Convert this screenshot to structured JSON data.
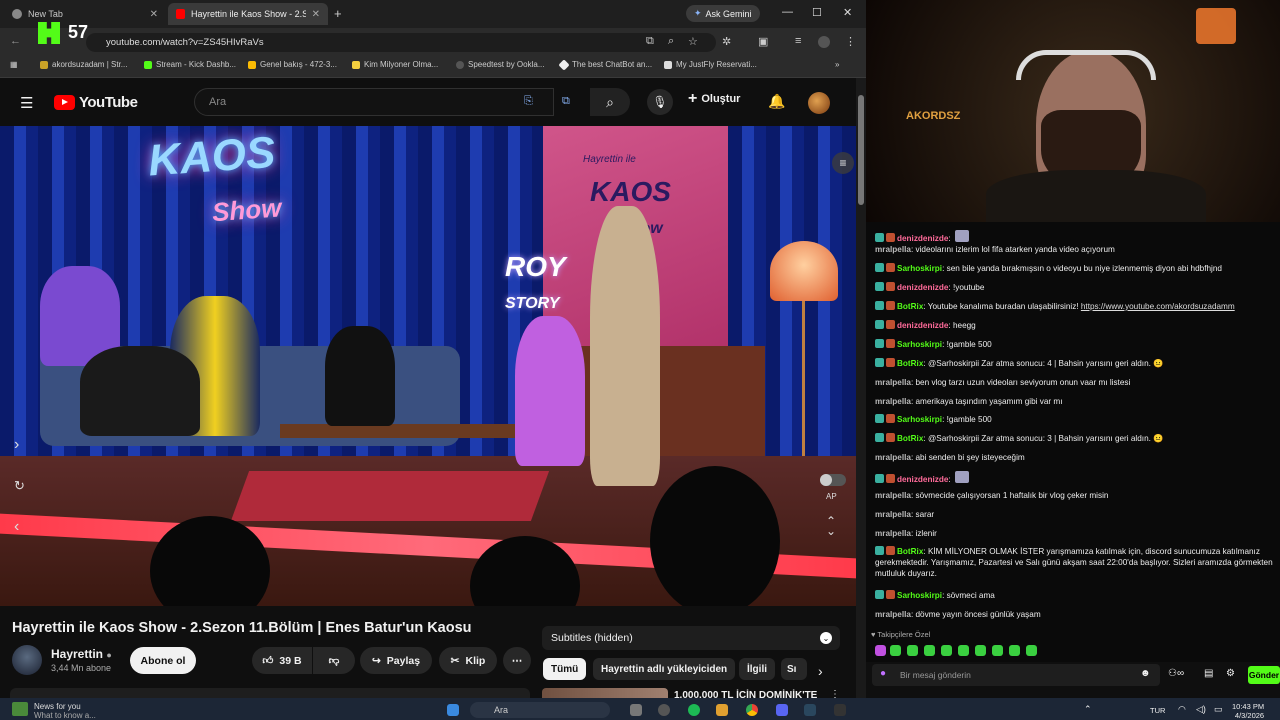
{
  "browser": {
    "tabs": [
      {
        "label": "New Tab",
        "active": false
      },
      {
        "label": "Hayrettin ile Kaos Show - 2.Sez",
        "active": true
      }
    ],
    "ask_gemini": "Ask Gemini",
    "url": "youtube.com/watch?v=ZS45HIvRaVs",
    "bookmarks": [
      "akordsuzadam | Str...",
      "Stream - Kick Dashb...",
      "Genel bakış - 472-3...",
      "Kim Milyoner Olma...",
      "Speedtest by Ookla...",
      "The best ChatBot an...",
      "My JustFly Reservati..."
    ]
  },
  "kick_overlay": {
    "logo": "K",
    "count": "57"
  },
  "youtube": {
    "logo": "YouTube",
    "search_placeholder": "Ara",
    "create_label": "Oluştur",
    "video_title": "Hayrettin ile Kaos Show - 2.Sezon 11.Bölüm | Enes Batur'un Kaosu",
    "channel": {
      "name": "Hayrettin",
      "subscribers": "3,44 Mn abone",
      "subscribe_label": "Abone ol"
    },
    "actions": {
      "likes": "39 B",
      "share": "Paylaş",
      "clip": "Klip"
    },
    "ap_label": "AP",
    "subtitles_label": "Subtitles (hidden)",
    "chips": [
      "Tümü",
      "Hayrettin adlı yükleyiciden",
      "İlgili",
      "Sı"
    ],
    "next_video_title": "1.000.000 TL İÇİN DOMİNİK'TE",
    "video_signs": {
      "kaos": "KAOS",
      "show": "Show",
      "roy": "ROY",
      "story": "STORY",
      "small": "Hayrettin ile",
      "panel_kaos": "KAOS",
      "panel_show": "Show"
    },
    "stream_overlay_label": "AKORDSZ"
  },
  "chat": {
    "messages": [
      {
        "user": "denizdenizde",
        "text": ":",
        "color": "#ff6b9a",
        "emote": true
      },
      {
        "user": "mralpella",
        "text": ": videolarını izlerim lol fifa atarken yanda video açıyorum",
        "color": "#bbbbbb"
      },
      {
        "user": "Sarhoskirpi",
        "text": ": sen bile yanda bırakmışsın o videoyu bu niye izlenmemiş diyon abi hdbfhjnd",
        "color": "#53fc18"
      },
      {
        "user": "denizdenizde",
        "text": ": !youtube",
        "color": "#ff6b9a"
      },
      {
        "user": "BotRix",
        "text": ": Youtube kanalıma buradan ulaşabilirsiniz! ",
        "link": "https://www.youtube.com/akordsuzadamm",
        "color": "#53fc18"
      },
      {
        "user": "denizdenizde",
        "text": ": heegg",
        "color": "#ff6b9a"
      },
      {
        "user": "Sarhoskirpi",
        "text": ": !gamble 500",
        "color": "#53fc18"
      },
      {
        "user": "BotRix",
        "text": ": @Sarhoskirpii Zar atma sonucu: 4 | Bahsin yarısını geri aldın. 😐",
        "color": "#53fc18"
      },
      {
        "user": "mralpella",
        "text": ": ben vlog tarzı uzun videoları seviyorum onun vaar mı listesi",
        "color": "#bbbbbb"
      },
      {
        "user": "mralpella",
        "text": ": amerikaya taşındım yaşamım gibi var mı",
        "color": "#bbbbbb"
      },
      {
        "user": "Sarhoskirpi",
        "text": ": !gamble 500",
        "color": "#53fc18"
      },
      {
        "user": "BotRix",
        "text": ": @Sarhoskirpii Zar atma sonucu: 3 | Bahsin yarısını geri aldın. 😐",
        "color": "#53fc18"
      },
      {
        "user": "mralpella",
        "text": ": abi senden bi şey isteyeceğim",
        "color": "#bbbbbb"
      },
      {
        "user": "denizdenizde",
        "text": ":",
        "color": "#ff6b9a",
        "emote": true
      },
      {
        "user": "mralpella",
        "text": ": sövmecide çalışıyorsan 1 haftalık bir vlog çeker misin",
        "color": "#bbbbbb"
      },
      {
        "user": "mralpella",
        "text": ": sarar",
        "color": "#bbbbbb"
      },
      {
        "user": "mralpella",
        "text": ": izlenir",
        "color": "#bbbbbb"
      },
      {
        "user": "BotRix",
        "text": ": KİM MİLYONER OLMAK İSTER yarışmamıza katılmak için, discord sunucumuza katılmanız",
        "cont": "gerekmektedir. Yarışmamız, Pazartesi ve Salı günü akşam saat 22:00'da başlıyor. Sizleri aramızda görmekten",
        "cont2": "mutluluk duyarız.",
        "color": "#53fc18"
      },
      {
        "user": "Sarhoskirpi",
        "text": ": sövmeci ama",
        "color": "#53fc18"
      },
      {
        "user": "mralpella",
        "text": ": dövme yayın öncesi günlük yaşam",
        "color": "#bbbbbb"
      }
    ],
    "followers_only": "Takipçilere Özel",
    "input_placeholder": "Bir mesaj gönderin",
    "send_label": "Gönder"
  },
  "taskbar": {
    "weather_line1": "News for you",
    "weather_line2": "What to know a...",
    "search_label": "Ara",
    "lang": "TUR",
    "time": "10:43 PM",
    "date": "4/3/2026"
  }
}
